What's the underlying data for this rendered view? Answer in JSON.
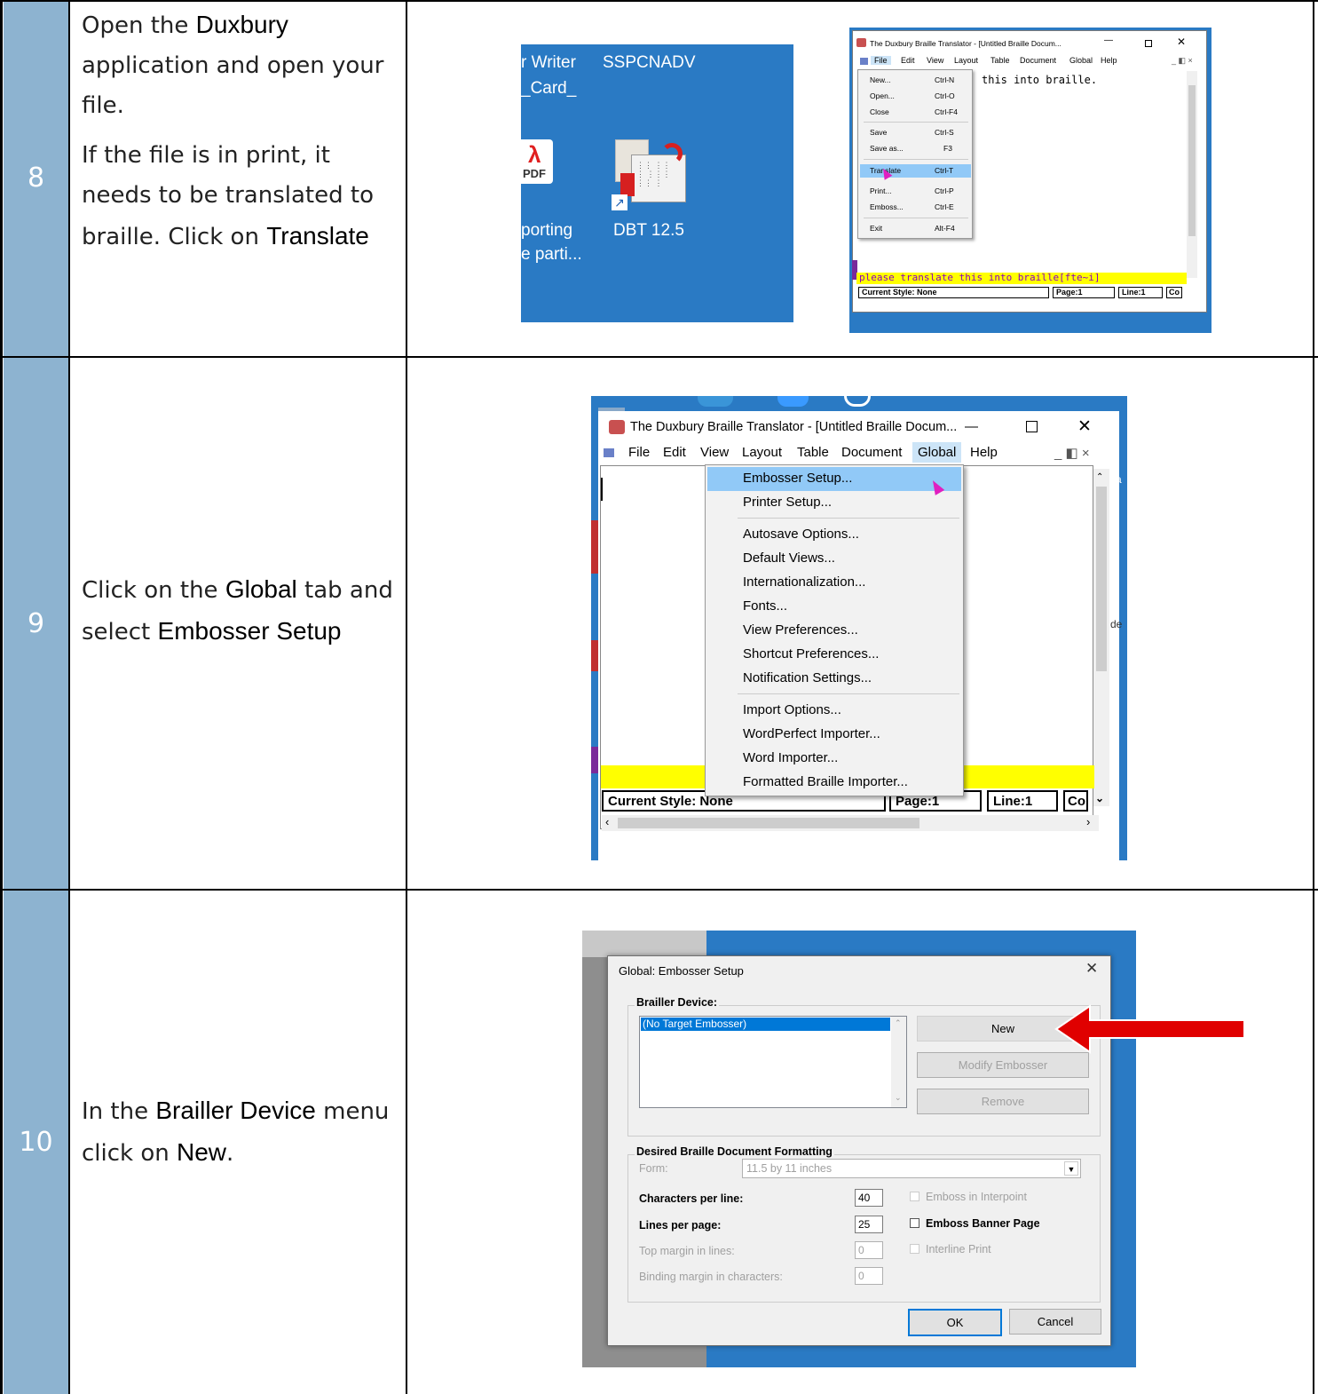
{
  "rows": [
    {
      "number": "8",
      "p1": {
        "a": "Open the ",
        "b": "Duxbury",
        "c": " application and open your file."
      },
      "p2": {
        "a": "If the file is in print, it needs to be translated to braille. Click on ",
        "b": "Translate"
      }
    },
    {
      "number": "9",
      "p1": {
        "a": "Click on the ",
        "b": "Global",
        "c": " tab and select ",
        "d": "Embosser Setup"
      }
    },
    {
      "number": "10",
      "p1": {
        "a": "In the ",
        "b": "Brailler Device",
        "c": " menu click on ",
        "d": "New",
        "e": "."
      }
    }
  ],
  "desktop": {
    "labels": [
      "r Writer",
      "SSPCNADV",
      "_Card_",
      "porting",
      "e parti...",
      "DBT 12.5"
    ],
    "pdf_label": "PDF"
  },
  "dbt_small": {
    "title": "The Duxbury Braille Translator - [Untitled Braille Docum...",
    "menubar": [
      "File",
      "Edit",
      "View",
      "Layout",
      "Table",
      "Document",
      "Global",
      "Help"
    ],
    "file_menu": [
      {
        "label": "New...",
        "key": "Ctrl-N"
      },
      {
        "label": "Open...",
        "key": "Ctrl-O"
      },
      {
        "label": "Close",
        "key": "Ctrl-F4"
      },
      {
        "label": "Save",
        "key": "Ctrl-S"
      },
      {
        "label": "Save as...",
        "key": "F3"
      },
      {
        "label": "Translate",
        "key": "Ctrl-T"
      },
      {
        "label": "Print...",
        "key": "Ctrl-P"
      },
      {
        "label": "Emboss...",
        "key": "Ctrl-E"
      },
      {
        "label": "Exit",
        "key": "Alt-F4"
      }
    ],
    "doc_text": "this into braille.",
    "yellow_text": "please translate this into braille[fte~i]",
    "status": {
      "style": "Current Style: None",
      "page": "Page:1",
      "line": "Line:1",
      "col": "Co"
    }
  },
  "dbt_large": {
    "title": "The Duxbury Braille Translator - [Untitled Braille Docum...",
    "menubar": [
      "File",
      "Edit",
      "View",
      "Layout",
      "Table",
      "Document",
      "Global",
      "Help"
    ],
    "global_menu": [
      "Embosser Setup...",
      "Printer Setup...",
      "Autosave Options...",
      "Default Views...",
      "Internationalization...",
      "Fonts...",
      "View Preferences...",
      "Shortcut Preferences...",
      "Notification Settings...",
      "Import Options...",
      "WordPerfect Importer...",
      "Word Importer...",
      "Formatted Braille Importer..."
    ],
    "side_fragments": {
      "a": "Sa",
      "b": "de"
    },
    "status": {
      "style": "Current Style: None",
      "page": "Page:1",
      "line": "Line:1",
      "col": "Co"
    }
  },
  "embosser_dialog": {
    "title": "Global: Embosser Setup",
    "brailler_group": "Brailler Device:",
    "list_item": "(No Target Embosser)",
    "buttons": {
      "new": "New",
      "modify": "Modify Embosser",
      "remove": "Remove",
      "ok": "OK",
      "cancel": "Cancel"
    },
    "formatting_group": "Desired Braille Document Formatting",
    "form_label": "Form:",
    "form_value": "11.5 by 11 inches",
    "fields": [
      {
        "label": "Characters per line:",
        "value": "40"
      },
      {
        "label": "Lines per page:",
        "value": "25"
      },
      {
        "label": "Top margin in lines:",
        "value": "0"
      },
      {
        "label": "Binding margin in characters:",
        "value": "0"
      }
    ],
    "checkboxes": [
      "Emboss in Interpoint",
      "Emboss Banner Page",
      "Interline Print"
    ],
    "accent_color": "#e00000"
  }
}
